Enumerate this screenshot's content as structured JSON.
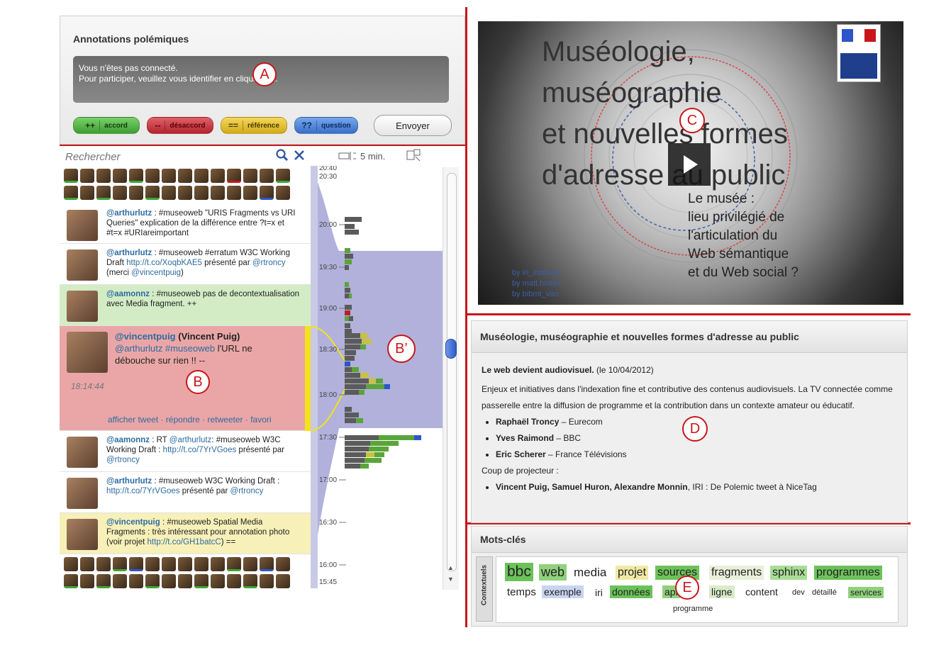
{
  "annotations": {
    "title": "Annotations polémiques",
    "message_line1": "Vous n'êtes pas connecté.",
    "message_line2": "Pour participer, veuillez vous identifier en cliquant ici.",
    "buttons": {
      "accord_symbol": "++",
      "accord_label": "accord",
      "desaccord_symbol": "--",
      "desaccord_label": "désaccord",
      "reference_symbol": "==",
      "reference_label": "référence",
      "question_symbol": "??",
      "question_label": "question",
      "send_label": "Envoyer"
    }
  },
  "markers": {
    "A": "A",
    "B": "B",
    "Bp": "B’",
    "C": "C",
    "D": "D",
    "E": "E"
  },
  "search": {
    "placeholder": "Rechercher",
    "zoom_label": "5 min."
  },
  "tweets": [
    {
      "user": "@arthurlutz",
      "text": " : #museoweb \"URIS Fragments vs URI Queries\" explication de la différence entre ?t=x et #t=x #URIareimportant"
    },
    {
      "user": "@arthurlutz",
      "text_a": " : #museoweb #erratum W3C Working Draft ",
      "link": "http://t.co/XoqbKAE5",
      "text_b": " présenté par ",
      "mention": "@rtroncy",
      "text_c": " (merci ",
      "mention2": "@vincentpuig",
      "text_d": ")"
    },
    {
      "user": "@aamonnz",
      "text": " : #museoweb pas de decontextualisation avec Media fragment. ++"
    },
    {
      "user": "@vincentpuig",
      "name": " (Vincent Puig)",
      "line2": "@arthurlutz #museoweb",
      "line2b": " l'URL ne débouche sur rien !! --",
      "time": "18:14:44",
      "actions": "afficher tweet · répondre · retweeter · favori"
    },
    {
      "user": "@aamonnz",
      "text_a": " : RT ",
      "mention": "@arthurlutz",
      "text_b": ": #museoweb W3C Working Draft : ",
      "link": "http://t.co/7YrVGoes",
      "text_c": " présenté par ",
      "mention2": "@rtroncy"
    },
    {
      "user": "@arthurlutz",
      "text_a": " : #museoweb W3C Working Draft : ",
      "link": "http://t.co/7YrVGoes",
      "text_b": " présenté par ",
      "mention": "@rtroncy"
    },
    {
      "user": "@vincentpuig",
      "text_a": " : #museoweb Spatial Media Fragments : très intéressant pour annotation photo (voir projet ",
      "link": "http://t.co/GH1batcC",
      "text_b": ") =="
    }
  ],
  "timeline": {
    "labels": [
      "20:40",
      "20:30",
      "20:00",
      "19:30",
      "19:00",
      "18:30",
      "18:00",
      "17:30",
      "17:00",
      "16:30",
      "16:00",
      "15:45"
    ],
    "colors": {
      "accord": "#5aa53a",
      "desaccord": "#b8222a",
      "reference": "#c9c23a",
      "question": "#2e55c9",
      "neutral": "#5b5b5b",
      "selection": "#a9a9d8",
      "highlight": "#f4e21a"
    }
  },
  "video": {
    "slide_title_1": "Muséologie,",
    "slide_title_2": "muséographie",
    "slide_title_3": "et nouvelles formes",
    "slide_title_4": "d'adresse au public",
    "slide_sub_1": "Le musée :",
    "slide_sub_2": "lieu privilégié de",
    "slide_sub_3": "l'articulation du",
    "slide_sub_4": "Web sémantique",
    "slide_sub_5": "et du Web social ?",
    "credit_1": "by iri_institute",
    "credit_2": "by matt.hintsa",
    "credit_3": "by bibmt_van"
  },
  "description": {
    "title": "Muséologie, muséographie et nouvelles formes d'adresse au public",
    "subtitle": "Le web devient audiovisuel.",
    "date": " (le 10/04/2012)",
    "paragraph": "Enjeux et initiatives dans l'indexation fine et contributive des contenus audiovisuels. La TV connectée comme passerelle entre la diffusion de programme et la contribution dans un contexte amateur ou éducatif.",
    "speakers": [
      {
        "name": "Raphaël Troncy",
        "org": " – Eurecom"
      },
      {
        "name": "Yves Raimond",
        "org": " – BBC"
      },
      {
        "name": "Eric Scherer",
        "org": " – France Télévisions"
      }
    ],
    "projector_label": "Coup de projecteur :",
    "projector_names": "Vincent Puig, Samuel Huron, Alexandre Monnin",
    "projector_rest": ", IRI : De Polemic tweet à NiceTag"
  },
  "keywords": {
    "title": "Mots-clés",
    "side_label": "Contextuels",
    "words": [
      "bbc",
      "web",
      "media",
      "projet",
      "sources",
      "fragments",
      "sphinx",
      "programmes",
      "temps",
      "exemple",
      "iri",
      "données",
      "api",
      "ligne",
      "content",
      "dev",
      "détaillé",
      "services",
      "programme"
    ]
  }
}
